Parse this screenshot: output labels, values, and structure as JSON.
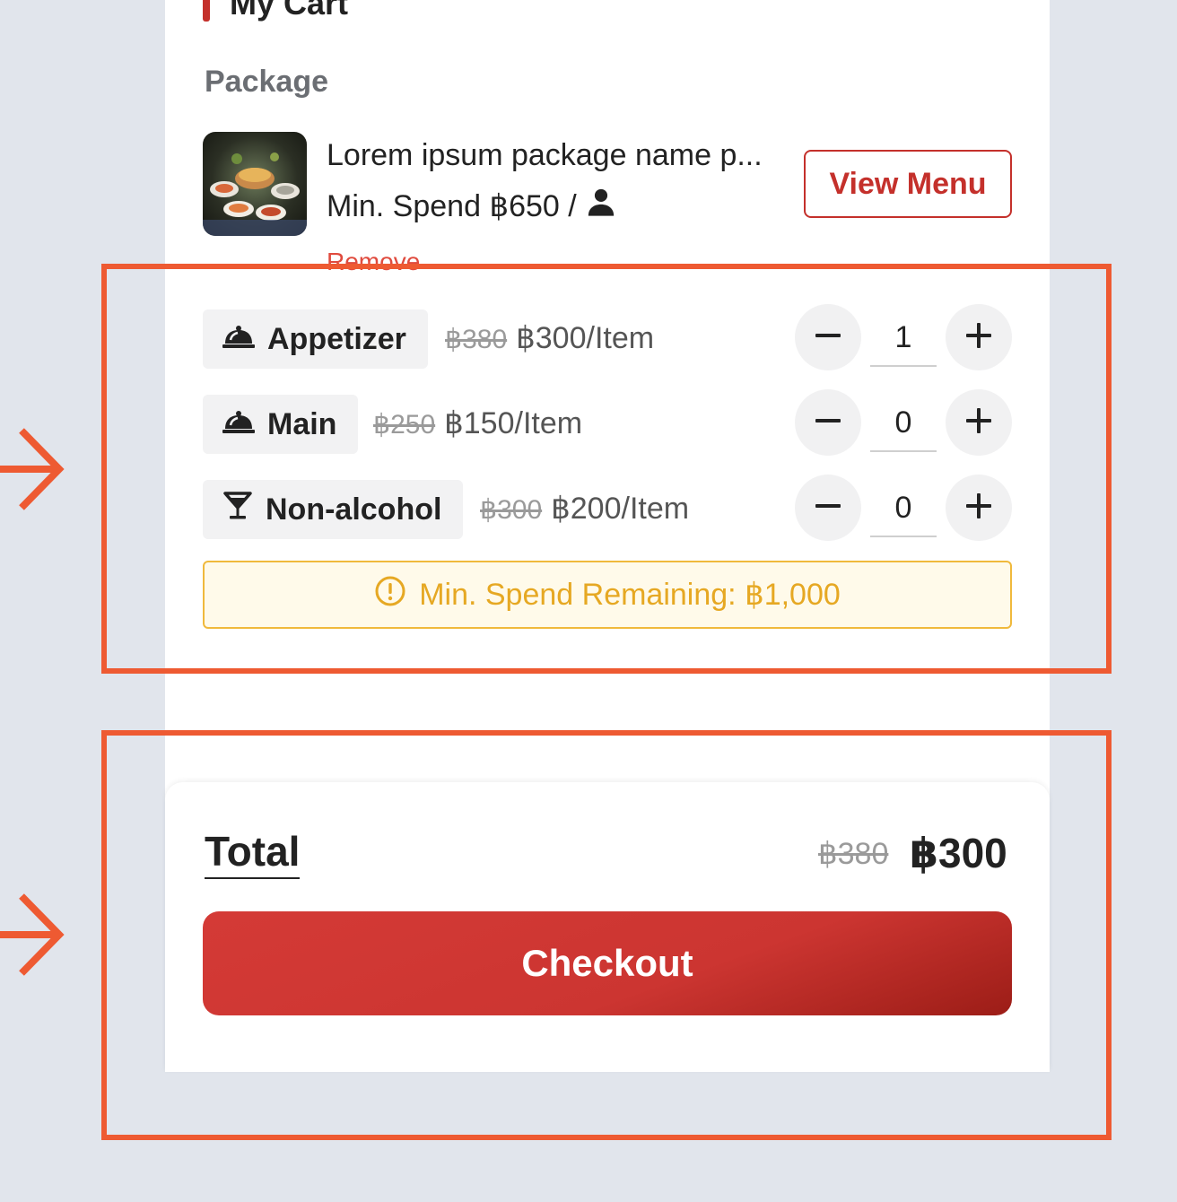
{
  "cart": {
    "title": "My Cart",
    "section_label": "Package",
    "package": {
      "name": "Lorem ipsum package name p...",
      "min_spend": "Min. Spend ฿650 /",
      "view_menu_label": "View Menu",
      "remove_label": "Remove"
    },
    "items": [
      {
        "name": "Appetizer",
        "icon": "cloche-icon",
        "old_price": "฿380",
        "price": "฿300/Item",
        "qty": "1"
      },
      {
        "name": "Main",
        "icon": "cloche-icon",
        "old_price": "฿250",
        "price": "฿150/Item",
        "qty": "0"
      },
      {
        "name": "Non-alcohol",
        "icon": "cocktail-glass-icon",
        "old_price": "฿300",
        "price": "฿200/Item",
        "qty": "0"
      }
    ],
    "min_spend_warning": "Min. Spend Remaining:  ฿1,000"
  },
  "footer": {
    "total_label": "Total",
    "old_total": "฿380",
    "total": "฿300",
    "checkout_label": "Checkout"
  },
  "colors": {
    "brand_red": "#c4302b",
    "warning_amber": "#e6a823",
    "annotation_orange": "#ee5a32",
    "background": "#e1e5ec"
  }
}
